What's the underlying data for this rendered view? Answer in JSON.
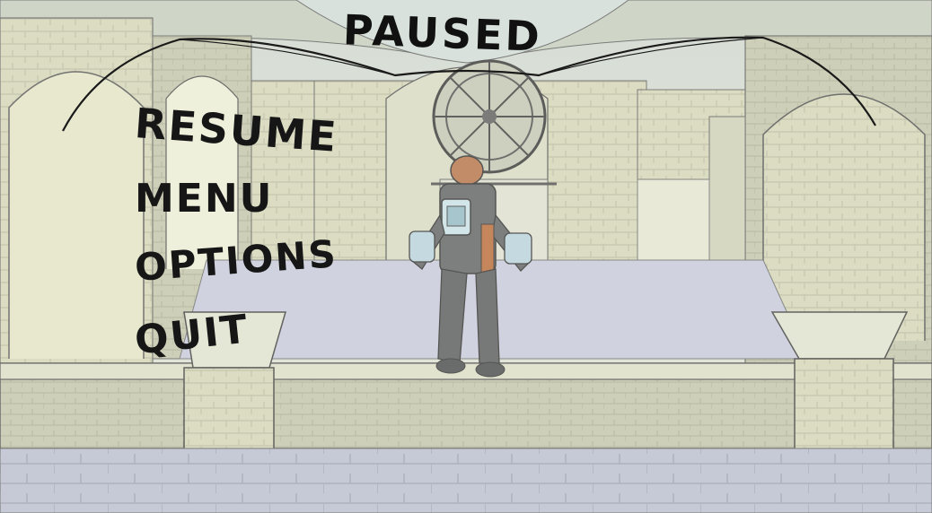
{
  "pause_menu": {
    "title": "PAUSED",
    "items": [
      {
        "id": "resume",
        "label": "Resume"
      },
      {
        "id": "menu",
        "label": "Menu"
      },
      {
        "id": "options",
        "label": "Options"
      },
      {
        "id": "quit",
        "label": "Quit"
      }
    ]
  },
  "colors": {
    "menu_text": "#161616",
    "overlay_tint": "#e6e8d2",
    "stone": "#c9cbb2",
    "floor": "#b7bccc"
  },
  "icons": [
    "ornamental-arc",
    "clock-window",
    "character-avatar"
  ]
}
